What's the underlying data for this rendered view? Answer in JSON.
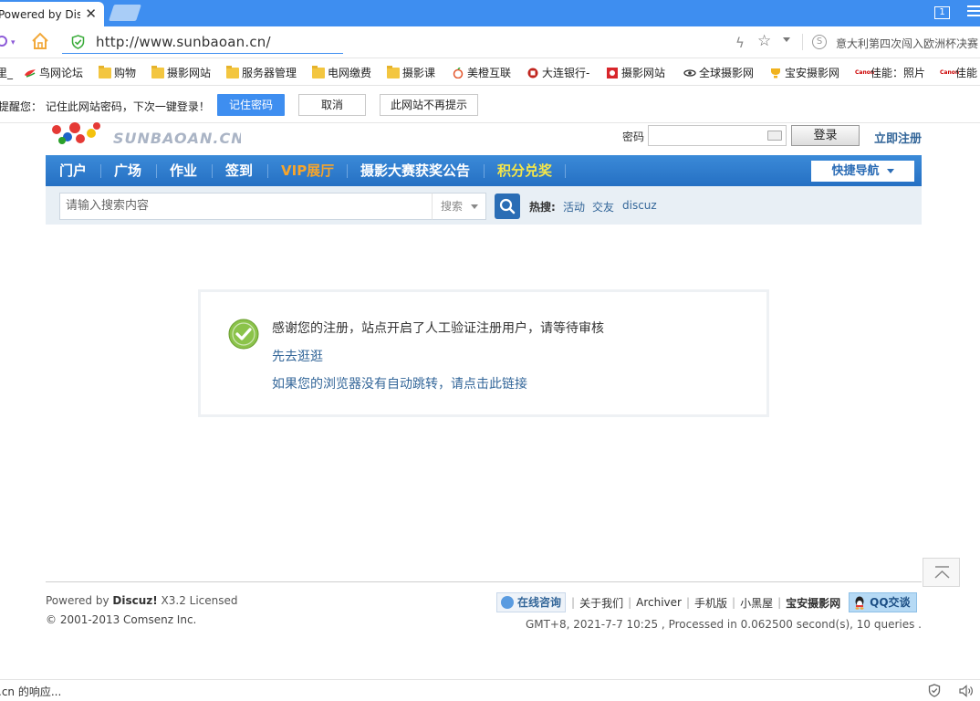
{
  "browser": {
    "tab_title": "Powered by Dis",
    "tab_close": "✕",
    "window_count": "1",
    "url": "http://www.sunbaoan.cn/",
    "news_ticker": "意大利第四次闯入欧洲杯决赛",
    "status_text": ".cn 的响应..."
  },
  "bookmarks": [
    {
      "label": "里_",
      "icon": "none"
    },
    {
      "label": "鸟网论坛",
      "icon": "bird-icon"
    },
    {
      "label": "购物",
      "icon": "folder-icon"
    },
    {
      "label": "摄影网站",
      "icon": "folder-icon"
    },
    {
      "label": "服务器管理",
      "icon": "folder-icon"
    },
    {
      "label": "电网缴费",
      "icon": "folder-icon"
    },
    {
      "label": "摄影课",
      "icon": "folder-icon"
    },
    {
      "label": "美橙互联",
      "icon": "orange-icon"
    },
    {
      "label": "大连银行-",
      "icon": "bank-icon"
    },
    {
      "label": "摄影网站",
      "icon": "photo-icon"
    },
    {
      "label": "全球摄影网",
      "icon": "globe-icon"
    },
    {
      "label": "宝安摄影网",
      "icon": "trophy-icon"
    },
    {
      "label": "佳能：照片",
      "icon": "canon-icon"
    },
    {
      "label": "佳能",
      "icon": "canon-icon"
    }
  ],
  "password_bar": {
    "prompt": "提醒您：  记住此网站密码，下次一键登录！",
    "remember": "记住密码",
    "cancel": "取消",
    "never": "此网站不再提示"
  },
  "site": {
    "logo_text": "SUNBAOAN.CN",
    "password_label": "密码",
    "login": "登录",
    "register": "立即注册",
    "nav": [
      {
        "label": "门户",
        "color": "#ffffff"
      },
      {
        "label": "广场",
        "color": "#ffffff"
      },
      {
        "label": "作业",
        "color": "#ffffff"
      },
      {
        "label": "签到",
        "color": "#ffffff"
      },
      {
        "label": "VIP展厅",
        "color": "#f7a52b"
      },
      {
        "label": "摄影大赛获奖公告",
        "color": "#ffffff"
      },
      {
        "label": "积分兑奖",
        "color": "#f4e64a"
      }
    ],
    "quick_nav": "快捷导航",
    "search_placeholder": "请输入搜索内容",
    "search_type": "搜索",
    "hot_label": "热搜:",
    "hot_links": [
      "活动",
      "交友",
      "discuz"
    ]
  },
  "message": {
    "main": "感谢您的注册，站点开启了人工验证注册用户，请等待审核",
    "link_go": "先去逛逛",
    "link_redirect": "如果您的浏览器没有自动跳转，请点击此链接"
  },
  "footer": {
    "powered_prefix": "Powered by ",
    "powered_brand": "Discuz!",
    "powered_suffix": " X3.2 Licensed",
    "copyright": "© 2001-2013 Comsenz Inc.",
    "consult": "在线咨询",
    "about": "关于我们",
    "archiver": "Archiver",
    "mobile": "手机版",
    "blackroom": "小黑屋",
    "sitename": "宝安摄影网",
    "qq": "QQ交谈",
    "process_info": "GMT+8, 2021-7-7 10:25 , Processed in 0.062500 second(s), 10 queries ."
  },
  "colors": {
    "browser_accent": "#3e8ef0",
    "nav_blue": "#2b7acd",
    "link_blue": "#336699",
    "success_green": "#8bc34a"
  }
}
